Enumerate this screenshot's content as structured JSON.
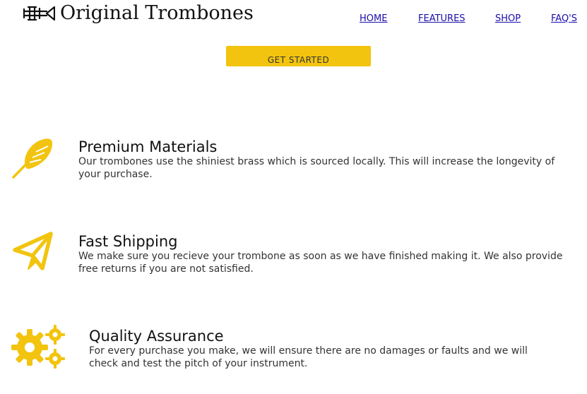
{
  "brand": {
    "logo_icon": "trombone-icon",
    "title": "Original Trombones"
  },
  "nav": {
    "items": [
      {
        "label": "HOME"
      },
      {
        "label": "FEATURES"
      },
      {
        "label": "SHOP"
      },
      {
        "label": "FAQ'S"
      }
    ]
  },
  "hero": {
    "cta_label": "GET STARTED"
  },
  "features": [
    {
      "icon": "feather-icon",
      "title": "Premium Materials",
      "description": "Our trombones use the shiniest brass which is sourced locally. This will increase the longevity of your purchase."
    },
    {
      "icon": "paper-plane-icon",
      "title": "Fast Shipping",
      "description": "We make sure you recieve your trombone as soon as we have finished making it. We also provide free returns if you are not satisfied."
    },
    {
      "icon": "gears-icon",
      "title": "Quality Assurance",
      "description": "For every purchase you make, we will ensure there are no damages or faults and we will check and test the pitch of your instrument."
    }
  ],
  "colors": {
    "accent": "#f2c40f",
    "link": "#1a0dab",
    "icon": "#f2c40f"
  }
}
